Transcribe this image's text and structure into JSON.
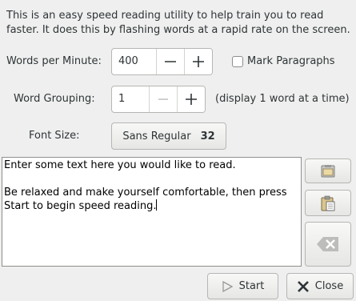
{
  "intro": "This is an easy speed reading utility to help train you to read faster. It does this by flashing words at a rapid rate on the screen.",
  "wpm": {
    "label": "Words per Minute:",
    "value": "400"
  },
  "mark_paragraphs": {
    "label": "Mark Paragraphs",
    "checked": false
  },
  "grouping": {
    "label": "Word Grouping:",
    "value": "1",
    "note": "(display 1 word at a time)"
  },
  "font": {
    "label": "Font Size:",
    "name": "Sans Regular",
    "size": "32"
  },
  "text_area": {
    "line1": "Enter some text here you would like to read.",
    "line2": "",
    "line3": "Be relaxed and make yourself comfortable, then press",
    "line4": "Start to begin speed reading."
  },
  "side_buttons": [
    "copy-icon",
    "paste-icon",
    "clear-icon"
  ],
  "buttons": {
    "start": "Start",
    "close": "Close"
  }
}
